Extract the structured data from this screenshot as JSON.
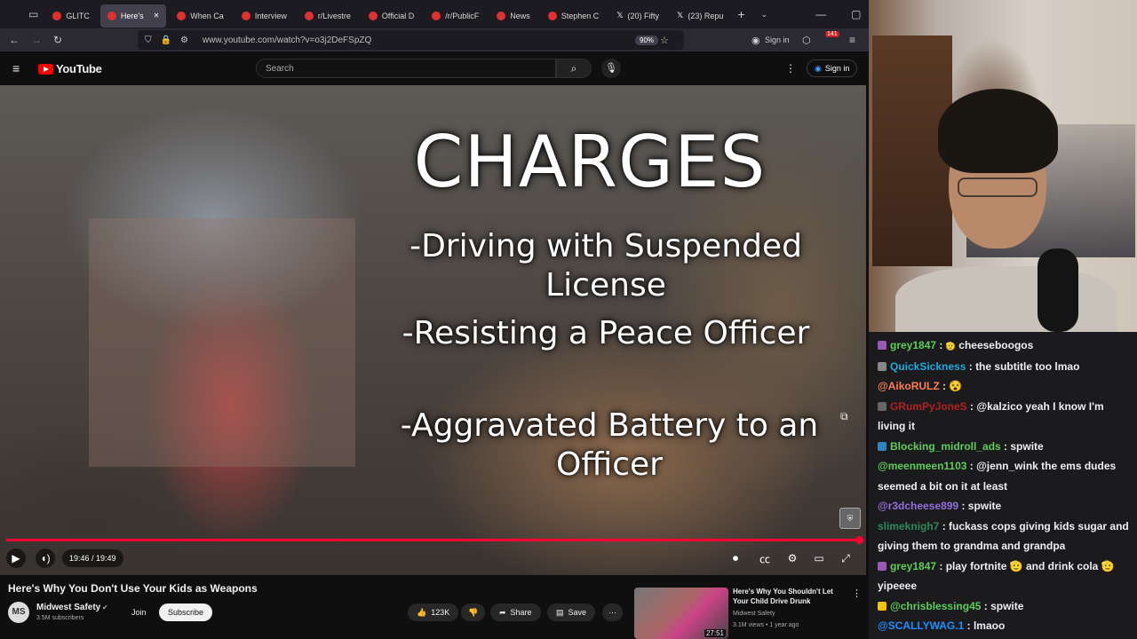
{
  "browser": {
    "tabs": [
      {
        "label": "GLITC",
        "active": false
      },
      {
        "label": "Here's",
        "active": true
      },
      {
        "label": "When Ca",
        "active": false
      },
      {
        "label": "Interview",
        "active": false
      },
      {
        "label": "r/Livestre",
        "active": false
      },
      {
        "label": "Official D",
        "active": false
      },
      {
        "label": "/r/PublicF",
        "active": false
      },
      {
        "label": "News",
        "active": false
      },
      {
        "label": "Stephen C",
        "active": false
      },
      {
        "label": "(20) Fifty",
        "active": false
      },
      {
        "label": "(23) Repu",
        "active": false
      }
    ],
    "new_tab": "+",
    "url": "www.youtube.com/watch?v=o3j2DeFSpZQ",
    "zoom": "90%",
    "signin": "Sign in",
    "extension_badge": "141"
  },
  "youtube": {
    "logo_text": "YouTube",
    "search_placeholder": "Search",
    "signin": "Sign in"
  },
  "video": {
    "overlay_title": "CHARGES",
    "charges": [
      "-Driving with Suspended License",
      "-Resisting a Peace Officer",
      "-Aggravated Battery to an Officer"
    ],
    "time": "19:46 / 19:49",
    "progress": 0.997,
    "title": "Here's Why You Don't Use Your Kids as Weapons",
    "channel": "Midwest Safety",
    "subscribers": "3.5M subscribers",
    "join": "Join",
    "subscribe": "Subscribe",
    "likes": "123K",
    "share": "Share",
    "save": "Save"
  },
  "recommended": {
    "title": "Here's Why You Shouldn't Let Your Child Drive Drunk",
    "channel": "Midwest Safety",
    "meta": "3.1M views • 1 year ago",
    "duration": "27:51"
  },
  "chat": [
    {
      "user": "grey1847",
      "color": "#5fcd5a",
      "badge": "#9b59b6",
      "text": "cheeseboogos",
      "emote_before": "🫡"
    },
    {
      "user": "QuickSickness",
      "color": "#1fa8e0",
      "badge": "#888",
      "text": "the subtitle too lmao"
    },
    {
      "user": "@AikoRULZ",
      "color": "#ff7f50",
      "badge": "",
      "text": "😵"
    },
    {
      "user": "GRumPyJoneS",
      "color": "#b22222",
      "badge": "#666",
      "text": "@kalzico yeah I know I'm living it"
    },
    {
      "user": "Blocking_midroll_ads",
      "color": "#5fcd5a",
      "badge": "#2e86c1",
      "text": "spwite"
    },
    {
      "user": "@meenmeen1103",
      "color": "#5fcd5a",
      "badge": "",
      "text": "@jenn_wink the ems dudes seemed a bit on it at least"
    },
    {
      "user": "@r3dcheese899",
      "color": "#9370db",
      "badge": "",
      "text": "spwite"
    },
    {
      "user": "slimeknigh7",
      "color": "#2e8b57",
      "badge": "",
      "text": "fuckass cops giving kids sugar and giving them to grandma and grandpa"
    },
    {
      "user": "grey1847",
      "color": "#5fcd5a",
      "badge": "#9b59b6",
      "text": "play fortnite 🫡 and drink cola 🫡 yipeeee"
    },
    {
      "user": "@chrisblessing45",
      "color": "#5fcd5a",
      "badge": "#f1c40f",
      "text": "spwite"
    },
    {
      "user": "@SCALLYWAG.1",
      "color": "#1e90ff",
      "badge": "",
      "text": "lmaoo"
    }
  ]
}
